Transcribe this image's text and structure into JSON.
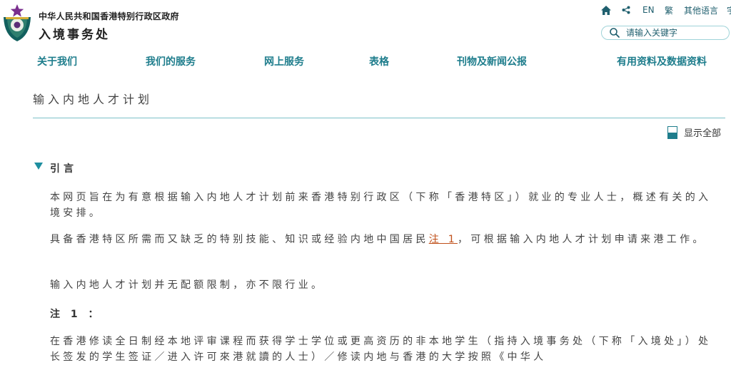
{
  "header": {
    "gov_name": "中华人民共和国香港特别行政区政府",
    "dept_name": "入境事务处",
    "utilities": {
      "en": "EN",
      "tc": "繁",
      "other_langs": "其他语言",
      "more": "宇"
    },
    "search_placeholder": "请输入关键字"
  },
  "nav": {
    "about": "关于我们",
    "services": "我们的服务",
    "eservices": "网上服务",
    "forms": "表格",
    "publications": "刊物及新闻公报",
    "info": "有用资料及数据资料"
  },
  "content": {
    "page_title": "输入内地人才计划",
    "expand_all": "显示全部",
    "section_title": "引言",
    "para_intro": "本网页旨在为有意根据输入内地人才计划前来香港特别行政区（下称「香港特区」）就业的专业人士，概述有关的入境安排。",
    "para_eligibility_before": "具备香港特区所需而又缺乏的特别技能、知识或经验内地中国居民",
    "note_link": "注 1",
    "para_eligibility_after": "，可根据输入内地人才计划申请来港工作。",
    "para_quota": "输入内地人才计划并无配额限制，亦不限行业。",
    "note_heading": "注 1 ：",
    "para_note": "在香港修读全日制经本地评审课程而获得学士学位或更高资历的非本地学生（指持入境事务处（下称「入境处」）处长签发的学生签证／进入许可來港就讀的人士）／修读内地与香港的大学按照《中华人"
  },
  "colors": {
    "brand_teal": "#1e7d8c",
    "link_orange": "#c0501a",
    "rule": "#7cc0c8"
  },
  "icons": [
    "hkimmd-emblem",
    "home-icon",
    "share-icon",
    "search-icon",
    "expand-all-icon",
    "caret-down-icon"
  ]
}
